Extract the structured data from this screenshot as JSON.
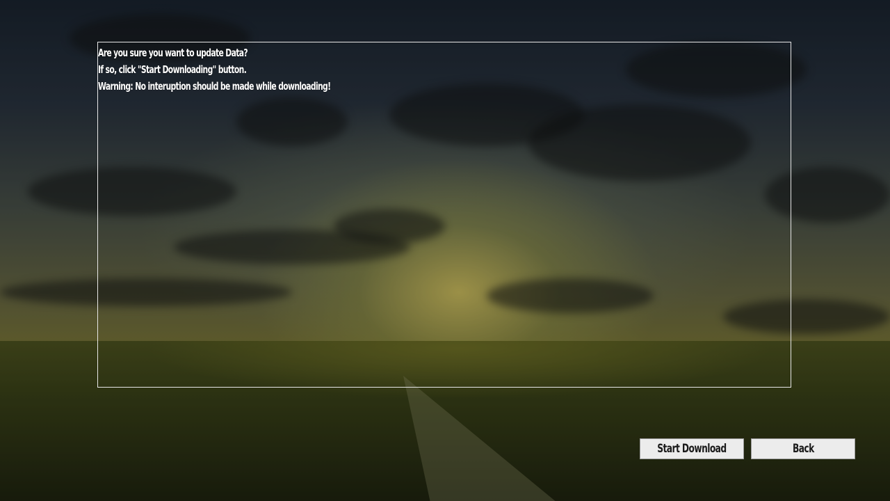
{
  "dialog": {
    "lines": [
      "Are you sure you want to update Data?",
      "If so, click \"Start Downloading\" button.",
      "Warning: No interuption should be made while downloading!"
    ]
  },
  "buttons": {
    "start_download": "Start Download",
    "back": "Back"
  },
  "colors": {
    "panel_border": "#e8e8e8",
    "text": "#ffffff",
    "button_bg": "#ececec",
    "button_text": "#1a1a1a"
  }
}
